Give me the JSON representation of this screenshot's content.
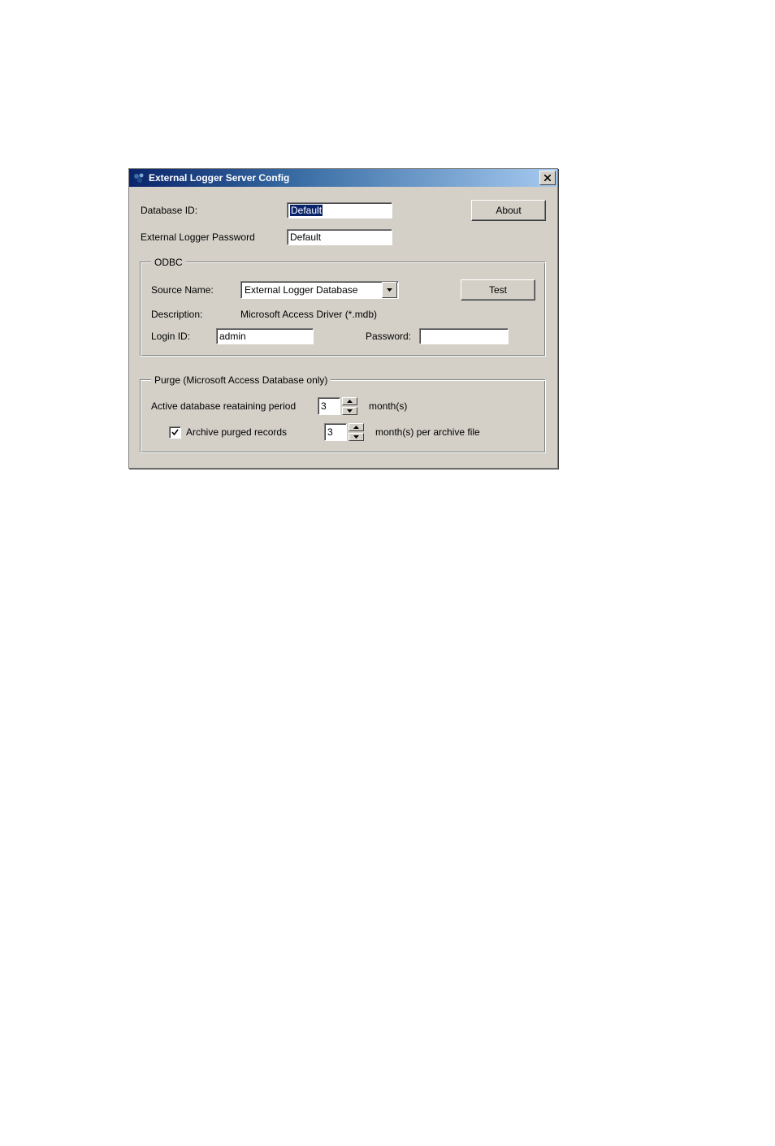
{
  "window": {
    "title": "External Logger Server Config"
  },
  "fields": {
    "database_id_label": "Database ID:",
    "database_id_value": "Default",
    "external_logger_password_label": "External Logger Password",
    "external_logger_password_value": "Default"
  },
  "buttons": {
    "about": "About",
    "test": "Test"
  },
  "odbc": {
    "legend": "ODBC",
    "source_name_label": "Source Name:",
    "source_name_value": "External Logger Database",
    "description_label": "Description:",
    "description_value": "Microsoft Access Driver (*.mdb)",
    "login_id_label": "Login ID:",
    "login_id_value": "admin",
    "password_label": "Password:",
    "password_value": ""
  },
  "purge": {
    "legend": "Purge (Microsoft Access Database only)",
    "retain_label": "Active database reataining period",
    "retain_value": "3",
    "retain_unit": "month(s)",
    "archive_checked": true,
    "archive_label": "Archive purged records",
    "archive_value": "3",
    "archive_unit": "month(s) per archive file"
  }
}
